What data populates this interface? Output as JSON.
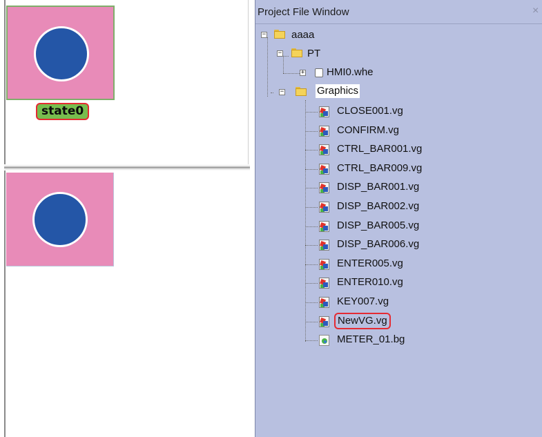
{
  "editor": {
    "state_label": "state0"
  },
  "project_window": {
    "title": "Project File Window",
    "close_glyph": "×",
    "tree": {
      "root": {
        "label": "aaaa",
        "expander": "−"
      },
      "pt": {
        "label": "PT",
        "expander": "−"
      },
      "hmi": {
        "label": "HMI0.whe",
        "expander": "+"
      },
      "graphics": {
        "label": "Graphics",
        "expander": "−"
      },
      "files": [
        {
          "label": "CLOSE001.vg",
          "icon": "vector-graphic-icon"
        },
        {
          "label": "CONFIRM.vg",
          "icon": "vector-graphic-icon"
        },
        {
          "label": "CTRL_BAR001.vg",
          "icon": "vector-graphic-icon"
        },
        {
          "label": "CTRL_BAR009.vg",
          "icon": "vector-graphic-icon"
        },
        {
          "label": "DISP_BAR001.vg",
          "icon": "vector-graphic-icon"
        },
        {
          "label": "DISP_BAR002.vg",
          "icon": "vector-graphic-icon"
        },
        {
          "label": "DISP_BAR005.vg",
          "icon": "vector-graphic-icon"
        },
        {
          "label": "DISP_BAR006.vg",
          "icon": "vector-graphic-icon"
        },
        {
          "label": "ENTER005.vg",
          "icon": "vector-graphic-icon"
        },
        {
          "label": "ENTER010.vg",
          "icon": "vector-graphic-icon"
        },
        {
          "label": "KEY007.vg",
          "icon": "vector-graphic-icon"
        },
        {
          "label": "NewVG.vg",
          "icon": "vector-graphic-icon",
          "highlighted": true
        },
        {
          "label": "METER_01.bg",
          "icon": "bitmap-graphic-icon"
        }
      ]
    }
  },
  "colors": {
    "panel_bg": "#b8c0e0",
    "tile_pink": "#e88bb8",
    "circle_blue": "#2456a7",
    "label_green": "#77bd4e",
    "highlight_red": "#e52a32"
  }
}
